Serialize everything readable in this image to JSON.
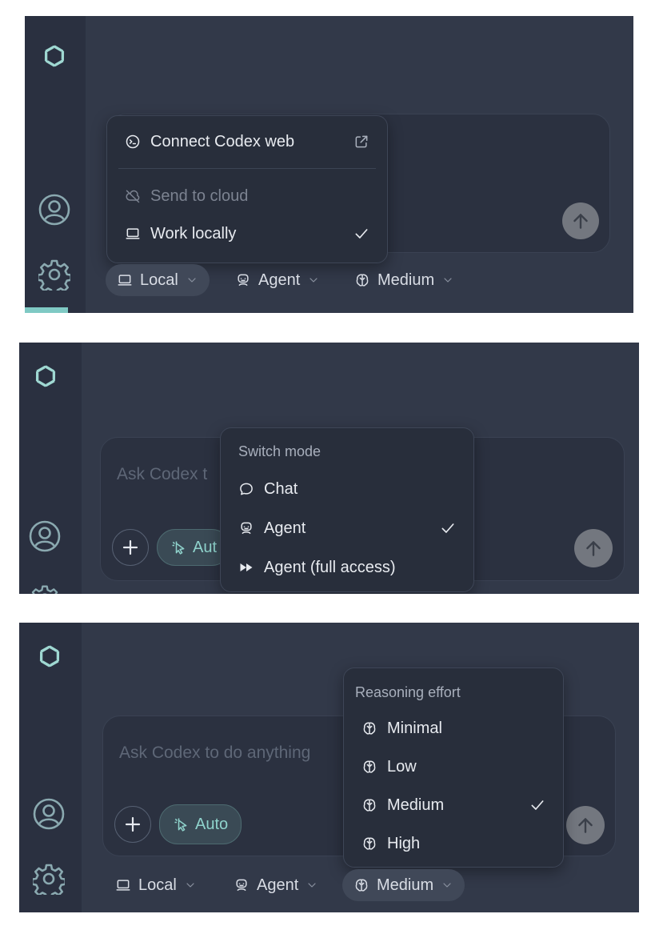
{
  "panel1": {
    "menu": {
      "connect_label": "Connect Codex web",
      "send_cloud_label": "Send to cloud",
      "work_locally_label": "Work locally"
    },
    "toolbar": {
      "local_label": "Local",
      "agent_label": "Agent",
      "medium_label": "Medium"
    }
  },
  "panel2": {
    "composer": {
      "placeholder": "Ask Codex t",
      "auto_label": "Aut"
    },
    "menu": {
      "heading": "Switch mode",
      "items": [
        {
          "label": "Chat",
          "icon": "chat-bubble-icon",
          "checked": false
        },
        {
          "label": "Agent",
          "icon": "robot-icon",
          "checked": true
        },
        {
          "label": "Agent (full access)",
          "icon": "fast-forward-icon",
          "checked": false
        }
      ]
    }
  },
  "panel3": {
    "composer": {
      "placeholder": "Ask Codex to do anything",
      "auto_label": "Auto"
    },
    "menu": {
      "heading": "Reasoning effort",
      "items": [
        {
          "label": "Minimal",
          "icon": "brain-icon",
          "checked": false
        },
        {
          "label": "Low",
          "icon": "brain-icon",
          "checked": false
        },
        {
          "label": "Medium",
          "icon": "brain-icon",
          "checked": true
        },
        {
          "label": "High",
          "icon": "brain-icon",
          "checked": false
        }
      ]
    },
    "toolbar": {
      "local_label": "Local",
      "agent_label": "Agent",
      "medium_label": "Medium"
    }
  },
  "colors": {
    "panel_bg": "#323949",
    "sidebar_bg": "#2a3040",
    "accent": "#8fd3cc",
    "menu_bg": "#282e3b"
  }
}
